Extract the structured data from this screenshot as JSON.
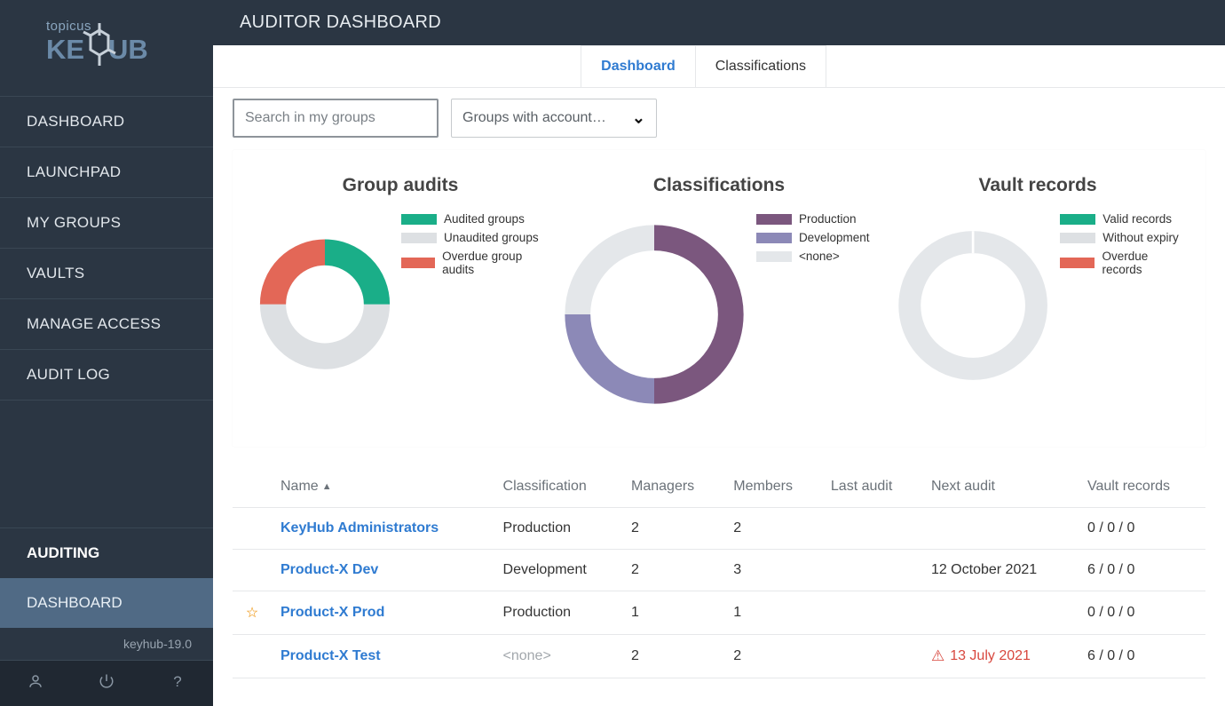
{
  "page_title": "AUDITOR DASHBOARD",
  "sidebar": {
    "items": [
      {
        "label": "DASHBOARD"
      },
      {
        "label": "LAUNCHPAD"
      },
      {
        "label": "MY GROUPS"
      },
      {
        "label": "VAULTS"
      },
      {
        "label": "MANAGE ACCESS"
      },
      {
        "label": "AUDIT LOG"
      }
    ],
    "section_title": "AUDITING",
    "subitem": "DASHBOARD",
    "version": "keyhub-19.0"
  },
  "tabs": [
    {
      "label": "Dashboard",
      "active": true
    },
    {
      "label": "Classifications",
      "active": false
    }
  ],
  "controls": {
    "search_placeholder": "Search in my groups",
    "filter_label": "Groups with account…"
  },
  "chart_data": [
    {
      "type": "pie",
      "title": "Group audits",
      "series": [
        {
          "name": "Audited groups",
          "value": 1,
          "color": "#1aae88"
        },
        {
          "name": "Unaudited groups",
          "value": 2,
          "color": "#dde0e3"
        },
        {
          "name": "Overdue group audits",
          "value": 1,
          "color": "#e36757"
        }
      ]
    },
    {
      "type": "pie",
      "title": "Classifications",
      "series": [
        {
          "name": "Production",
          "value": 2,
          "color": "#7b577e"
        },
        {
          "name": "Development",
          "value": 1,
          "color": "#8c89b7"
        },
        {
          "name": "<none>",
          "value": 1,
          "color": "#e4e7ea"
        }
      ]
    },
    {
      "type": "pie",
      "title": "Vault records",
      "series": [
        {
          "name": "Valid records",
          "value": 0,
          "color": "#1aae88"
        },
        {
          "name": "Without expiry",
          "value": 12,
          "color": "#dde0e3"
        },
        {
          "name": "Overdue records",
          "value": 0,
          "color": "#e36757"
        }
      ]
    }
  ],
  "table": {
    "headers": {
      "name": "Name",
      "classification": "Classification",
      "managers": "Managers",
      "members": "Members",
      "last_audit": "Last audit",
      "next_audit": "Next audit",
      "vault_records": "Vault records"
    },
    "rows": [
      {
        "starred": false,
        "name": "KeyHub Administrators",
        "classification": "Production",
        "managers": "2",
        "members": "2",
        "last_audit": "",
        "next_audit": "",
        "next_overdue": false,
        "vault": "0 / 0 / 0"
      },
      {
        "starred": false,
        "name": "Product-X Dev",
        "classification": "Development",
        "managers": "2",
        "members": "3",
        "last_audit": "",
        "next_audit": "12 October 2021",
        "next_overdue": false,
        "vault": "6 / 0 / 0"
      },
      {
        "starred": true,
        "name": "Product-X Prod",
        "classification": "Production",
        "managers": "1",
        "members": "1",
        "last_audit": "",
        "next_audit": "",
        "next_overdue": false,
        "vault": "0 / 0 / 0"
      },
      {
        "starred": false,
        "name": "Product-X Test",
        "classification": "<none>",
        "managers": "2",
        "members": "2",
        "last_audit": "",
        "next_audit": "13 July 2021",
        "next_overdue": true,
        "vault": "6 / 0 / 0"
      }
    ]
  }
}
